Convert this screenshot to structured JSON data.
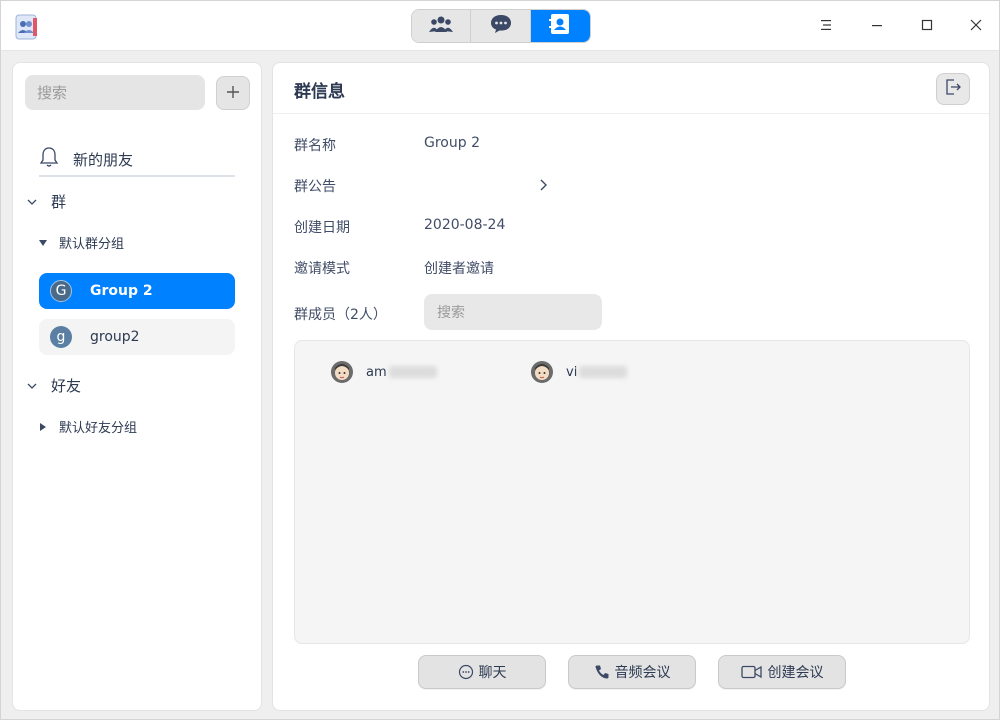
{
  "titlebar": {
    "nav_tabs": [
      {
        "name": "groups",
        "icon": "people-icon"
      },
      {
        "name": "chat",
        "icon": "chat-bubble-icon"
      },
      {
        "name": "contacts",
        "icon": "contact-card-icon"
      }
    ],
    "active_tab": "contacts"
  },
  "sidebar": {
    "search_placeholder": "搜索",
    "new_friends_label": "新的朋友",
    "groups_section_label": "群",
    "default_group_label": "默认群分组",
    "groups": [
      {
        "avatar_letter": "G",
        "name": "Group 2",
        "selected": true
      },
      {
        "avatar_letter": "g",
        "name": "group2",
        "selected": false
      }
    ],
    "friends_section_label": "好友",
    "default_friend_group_label": "默认好友分组"
  },
  "main": {
    "title": "群信息",
    "rows": [
      {
        "label": "群名称",
        "value": "Group 2"
      },
      {
        "label": "群公告",
        "value": ""
      },
      {
        "label": "创建日期",
        "value": "2020-08-24"
      },
      {
        "label": "邀请模式",
        "value": "创建者邀请"
      }
    ],
    "members_label": "群成员（2人）",
    "member_search_placeholder": "搜索",
    "members": [
      {
        "name_prefix": "am"
      },
      {
        "name_prefix": "vi"
      }
    ],
    "actions": {
      "chat": "聊天",
      "audio_meeting": "音频会议",
      "create_meeting": "创建会议"
    }
  },
  "colors": {
    "accent": "#0081ff",
    "text": "#414d68"
  }
}
